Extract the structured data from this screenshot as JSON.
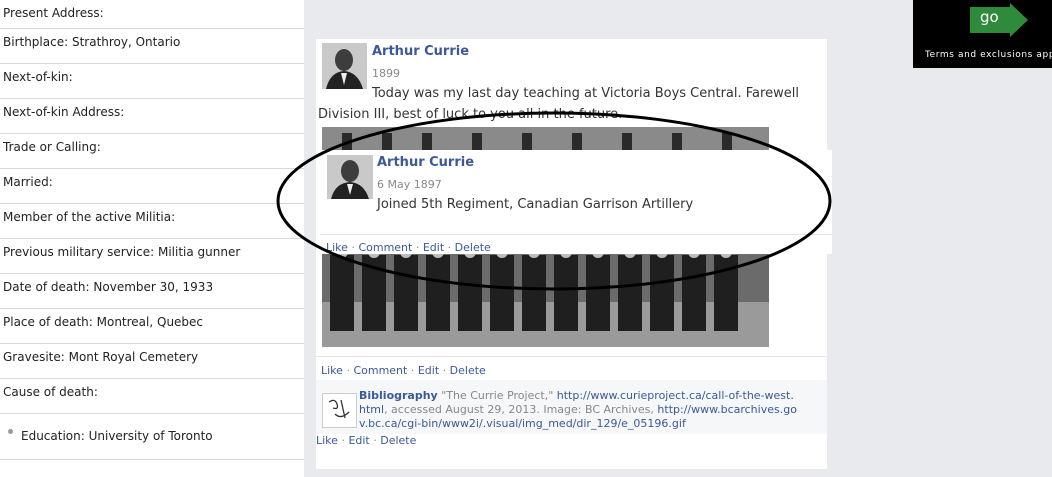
{
  "fields": [
    {
      "label": "Present Address:"
    },
    {
      "label": "Birthplace: Strathroy, Ontario"
    },
    {
      "label": "Next-of-kin:"
    },
    {
      "label": "Next-of-kin Address:"
    },
    {
      "label": "Trade or Calling:"
    },
    {
      "label": "Married:"
    },
    {
      "label": "Member of the active Militia:"
    },
    {
      "label": "Previous military service: Militia gunner"
    },
    {
      "label": "Date of death: November 30, 1933"
    },
    {
      "label": "Place of death: Montreal, Quebec"
    },
    {
      "label": "Gravesite: Mont Royal Cemetery"
    },
    {
      "label": "Cause of death:"
    }
  ],
  "education": "Education: University of Toronto",
  "ad": {
    "button": "go",
    "text": "Terms and exclusions app"
  },
  "post": {
    "author": "Arthur Currie",
    "date": "1899",
    "text": "Today was my last day teaching at Victoria Boys Central. Farewell Division III, best of luck to you all in the future.",
    "actions": {
      "like": "Like",
      "comment": "Comment",
      "edit": "Edit",
      "delete": "Delete",
      "sep": "·"
    }
  },
  "nested_post": {
    "author": "Arthur Currie",
    "date": "6 May 1897",
    "text": "Joined 5th Regiment, Canadian Garrison Artillery",
    "actions": {
      "like": "Like",
      "comment": "Comment",
      "edit": "Edit",
      "delete": "Delete",
      "sep": "·"
    }
  },
  "bibliography": {
    "label": "Bibliography",
    "text1": "\"The Currie Project,\"",
    "link1": "http://www.curieproject.ca/call-of-the-west.html",
    "text2": ", accessed August 29, 2013. Image: BC Archives,",
    "link2": "http://www.bcarchives.gov.bc.ca/cgi-bin/www2i/.visual/img_med/dir_129/e_05196.gif",
    "actions": {
      "like": "Like",
      "edit": "Edit",
      "delete": "Delete",
      "sep": "·"
    }
  },
  "colors": {
    "link": "#3b5998",
    "page_bg": "#e9eaed",
    "ad_bg": "#000000",
    "ad_arrow": "#2e8b3c"
  }
}
